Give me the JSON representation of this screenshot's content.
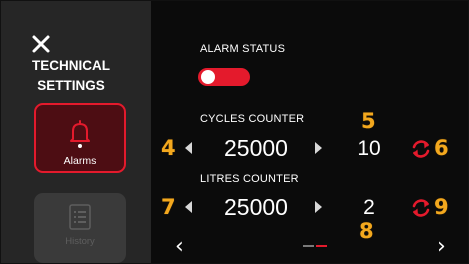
{
  "sidebar": {
    "title_line1": "TECHNICAL",
    "title_line2": "SETTINGS",
    "items": [
      {
        "label": "Alarms",
        "icon": "bell-icon",
        "active": true
      },
      {
        "label": "History",
        "icon": "list-icon",
        "active": false
      }
    ]
  },
  "alarm_status": {
    "label": "ALARM STATUS",
    "toggle_on": true
  },
  "cycles": {
    "label": "CYCLES COUNTER",
    "value": "25000",
    "counter": "10"
  },
  "litres": {
    "label": "LITRES COUNTER",
    "value": "25000",
    "counter": "2"
  },
  "callouts": [
    "4",
    "5",
    "6",
    "7",
    "8",
    "9"
  ],
  "pagination": {
    "pages": 2,
    "current": 2
  },
  "colors": {
    "accent": "#e41a2c",
    "callout": "#f3a81e",
    "sidebar_bg": "#262626",
    "main_bg": "#0b0b0b"
  }
}
